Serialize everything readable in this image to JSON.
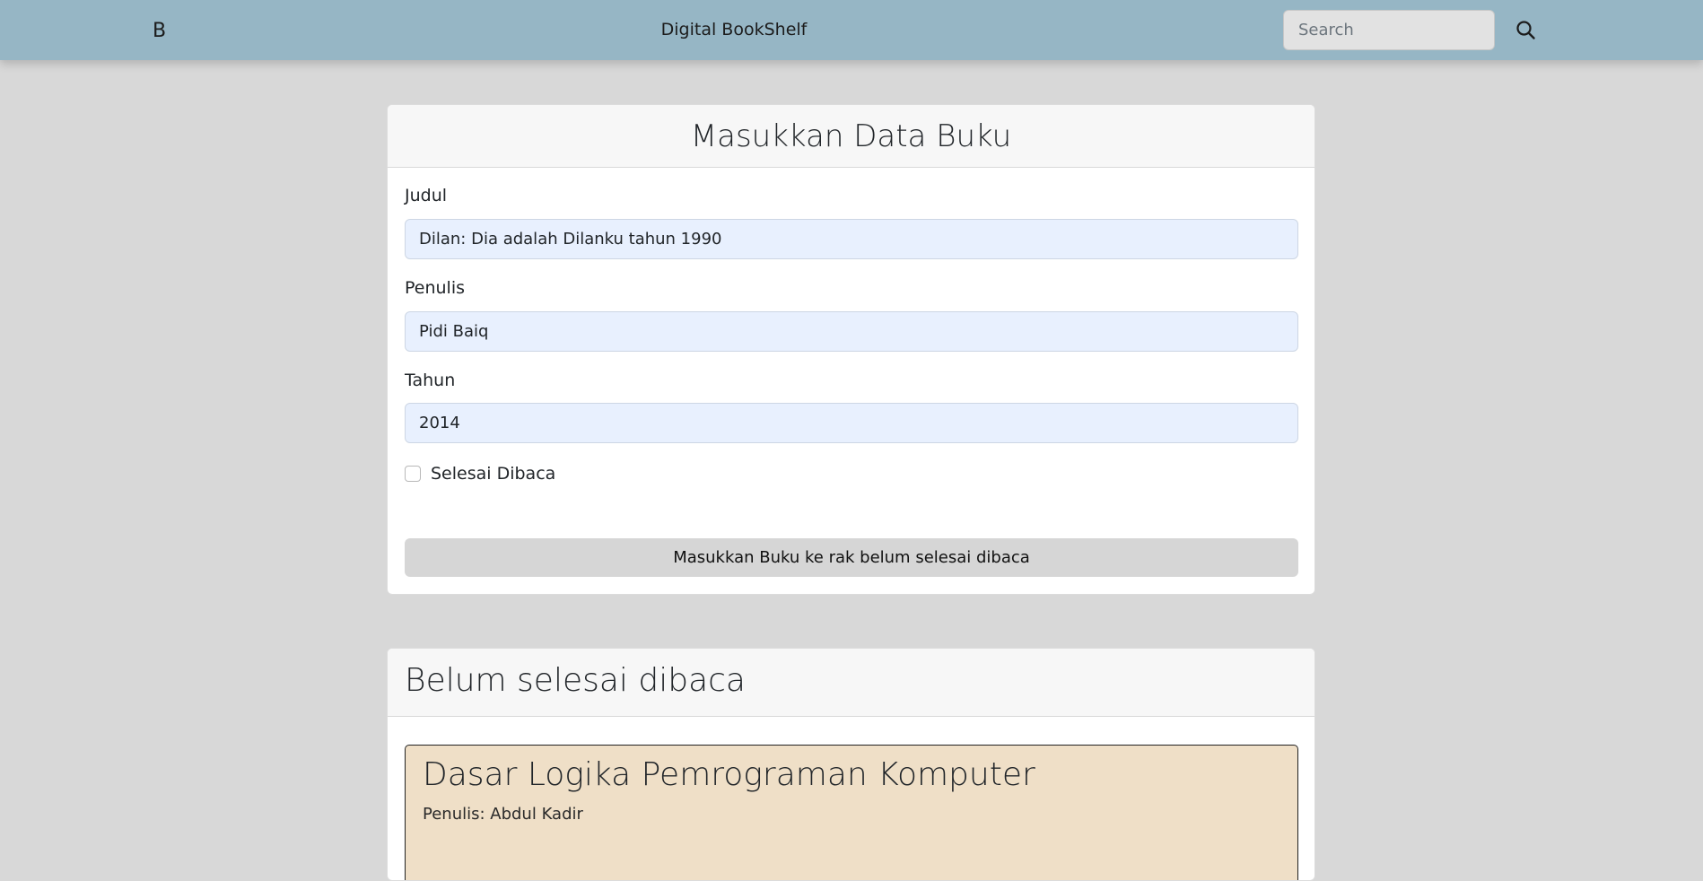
{
  "navbar": {
    "brand_letter": "B",
    "title": "Digital BookShelf",
    "search_placeholder": "Search",
    "search_icon": "search-icon"
  },
  "form": {
    "heading": "Masukkan Data Buku",
    "title_label": "Judul",
    "title_value": "Dilan: Dia adalah Dilanku tahun 1990",
    "author_label": "Penulis",
    "author_value": "Pidi Baiq",
    "year_label": "Tahun",
    "year_value": "2014",
    "finished_label": "Selesai Dibaca",
    "finished_checked": false,
    "submit_label": "Masukkan Buku ke rak belum selesai dibaca"
  },
  "unread_shelf": {
    "heading": "Belum selesai dibaca",
    "books": [
      {
        "title": "Dasar Logika Pemrograman Komputer",
        "author": "Penulis: Abdul Kadir"
      }
    ]
  },
  "colors": {
    "navbar": "#96b6c5",
    "page_background": "#d8d8d8",
    "book_item_background": "#efdfc7",
    "input_background": "#e8f0fe"
  }
}
